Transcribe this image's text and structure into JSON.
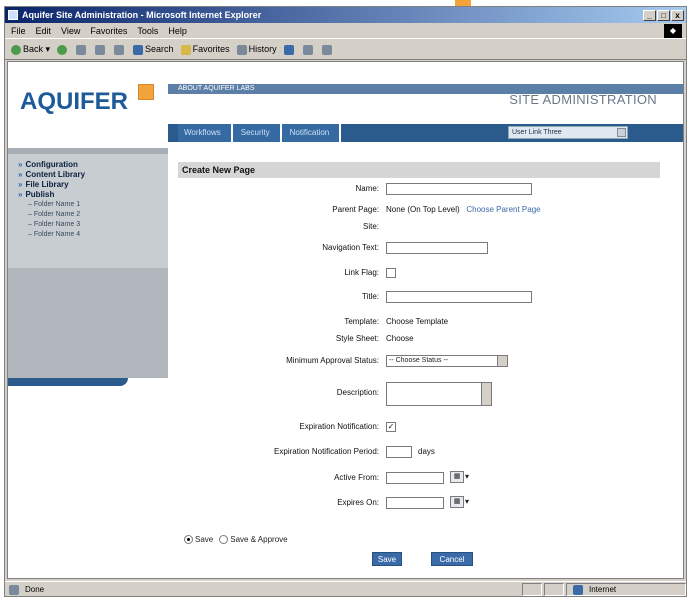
{
  "browser": {
    "title": "Aquifer Site Administration - Microsoft Internet Explorer",
    "window_buttons": [
      "_",
      "□",
      "x"
    ],
    "menu": [
      "File",
      "Edit",
      "View",
      "Favorites",
      "Tools",
      "Help"
    ],
    "toolbar": [
      "Back",
      "Search",
      "Favorites",
      "History"
    ],
    "status_left": "Done",
    "status_right": "Internet"
  },
  "header": {
    "logo": "AQUIFER",
    "breadcrumb": "ABOUT AQUIFER LABS",
    "site_title": "SITE ADMINISTRATION",
    "tabs": [
      "Workflows",
      "Security",
      "Notification"
    ],
    "user_select": "User Link Three"
  },
  "sidebar": {
    "items": [
      "Configuration",
      "Content Library",
      "File Library",
      "Publish"
    ],
    "sub_items": [
      "Folder Name 1",
      "Folder Name 2",
      "Folder Name 3",
      "Folder Name 4"
    ]
  },
  "form": {
    "heading": "Create New Page",
    "name_label": "Name:",
    "parent_label": "Parent Page:",
    "parent_value": "None (On Top Level)",
    "parent_link": "Choose Parent Page",
    "site_label": "Site:",
    "nav_text_label": "Navigation Text:",
    "link_flag_label": "Link Flag:",
    "title_label": "Title:",
    "template_label": "Template:",
    "template_value": "Choose Template",
    "style_label": "Style Sheet:",
    "style_link": "Choose",
    "approval_label": "Minimum Approval Status:",
    "approval_value": "-- Choose Status --",
    "description_label": "Description:",
    "expiry_notice_label": "Expiration Notification:",
    "expiry_notice_checked": "✓",
    "expiry_period_label": "Expiration Notification Period:",
    "expiry_period_unit": "days",
    "active_label": "Active From:",
    "expires_label": "Expires On:",
    "radio_save": "Save",
    "radio_save_approve": "Save & Approve",
    "btn_save": "Save",
    "btn_cancel": "Cancel"
  },
  "colors": {
    "accent": "#f2a33a",
    "brand_blue": "#1d5a9a",
    "nav_blue": "#2b5a8c"
  }
}
